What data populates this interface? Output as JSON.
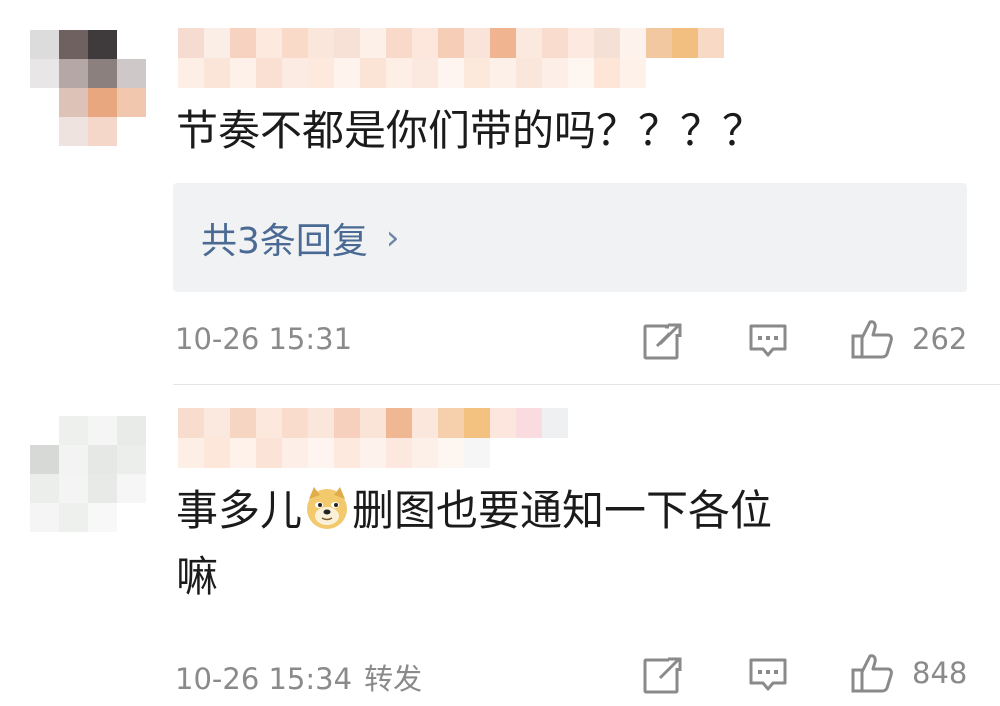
{
  "comments": [
    {
      "text": "节奏不都是你们带的吗？？？？",
      "replies_label": "共3条回复",
      "time": "10-26 15:31",
      "likes": "262"
    },
    {
      "text_before_emoji": "事多儿",
      "emoji": "doge-emoji",
      "text_after_emoji": "删图也要通知一下各位",
      "text_line2": "嘛",
      "time": "10-26 15:34",
      "forward_label": "转发",
      "likes": "848"
    }
  ],
  "icons": {
    "share": "share-icon",
    "comment": "comment-icon",
    "like": "thumbs-up-icon"
  },
  "colors": {
    "link_blue": "#4a6a94",
    "meta_gray": "#8a8a8a",
    "reply_bg": "#f1f2f3"
  }
}
